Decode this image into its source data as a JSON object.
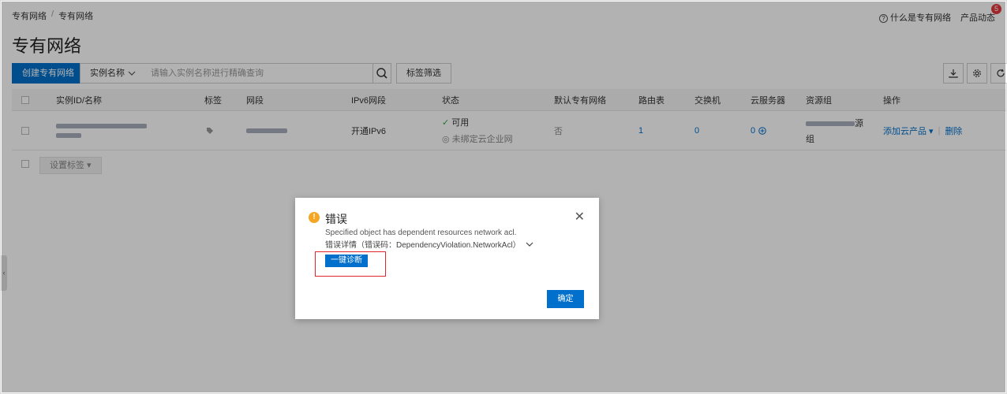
{
  "breadcrumb": {
    "root": "专有网络",
    "separator": "/",
    "current": "专有网络"
  },
  "header": {
    "help_label": "什么是专有网络",
    "news_label": "产品动态",
    "news_badge": "5"
  },
  "page_title": "专有网络",
  "toolbar": {
    "create_label": "创建专有网络",
    "filter_select_value": "实例名称",
    "search_placeholder": "请输入实例名称进行精确查询",
    "tag_filter_label": "标签筛选"
  },
  "table": {
    "headers": [
      "实例ID/名称",
      "标签",
      "网段",
      "IPv6网段",
      "状态",
      "默认专有网络",
      "路由表",
      "交换机",
      "云服务器",
      "资源组",
      "操作"
    ],
    "row": {
      "ipv6": "开通IPv6",
      "status_primary": "可用",
      "status_secondary": "未绑定云企业网",
      "default_vpc": "否",
      "route_tables": "1",
      "vswitches": "0",
      "ecs": "0",
      "resource_group_suffix": "源",
      "resource_group_line2": "组",
      "action_add": "添加云产品",
      "action_delete": "删除"
    },
    "set_tag_label": "设置标签"
  },
  "dialog": {
    "title": "错误",
    "message": "Specified object has dependent resources network acl.",
    "detail": "错误详情（错误码：DependencyViolation.NetworkAcl）",
    "diagnose_label": "一键诊断",
    "ok_label": "确定"
  },
  "colors": {
    "primary": "#0070cc",
    "warning": "#f5a623",
    "highlight": "#e0262c",
    "badge": "#e4393c"
  }
}
